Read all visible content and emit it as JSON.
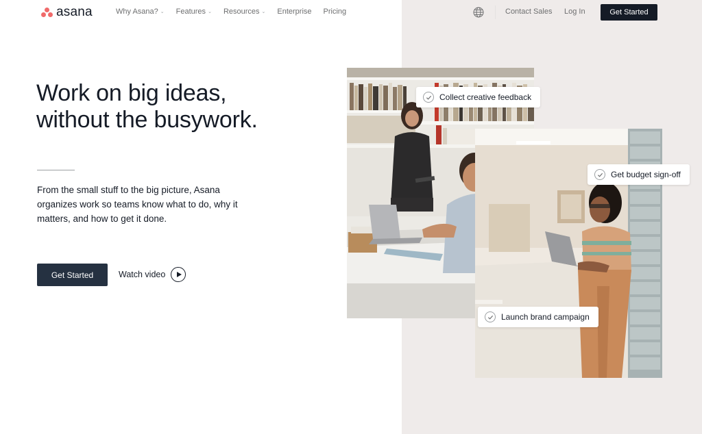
{
  "brand": {
    "name": "asana",
    "accent": "#f06a6a"
  },
  "nav": {
    "items": [
      {
        "label": "Why Asana?",
        "has_chevron": true
      },
      {
        "label": "Features",
        "has_chevron": true
      },
      {
        "label": "Resources",
        "has_chevron": true
      },
      {
        "label": "Enterprise",
        "has_chevron": false
      },
      {
        "label": "Pricing",
        "has_chevron": false
      }
    ],
    "chevron": "⌄",
    "globe_icon": "globe-icon",
    "contact_sales": "Contact Sales",
    "log_in": "Log In",
    "get_started": "Get Started"
  },
  "hero": {
    "headline": "Work on big ideas, without the busywork.",
    "subtext": "From the small stuff to the big picture, Asana organizes work so teams know what to do, why it matters, and how to get it done.",
    "cta_primary": "Get Started",
    "cta_secondary": "Watch video"
  },
  "callouts": [
    {
      "label": "Collect creative feedback"
    },
    {
      "label": "Get budget sign-off"
    },
    {
      "label": "Launch brand campaign"
    }
  ],
  "colors": {
    "dark": "#151b26",
    "button": "#253141",
    "panel_bg": "#efebea"
  }
}
